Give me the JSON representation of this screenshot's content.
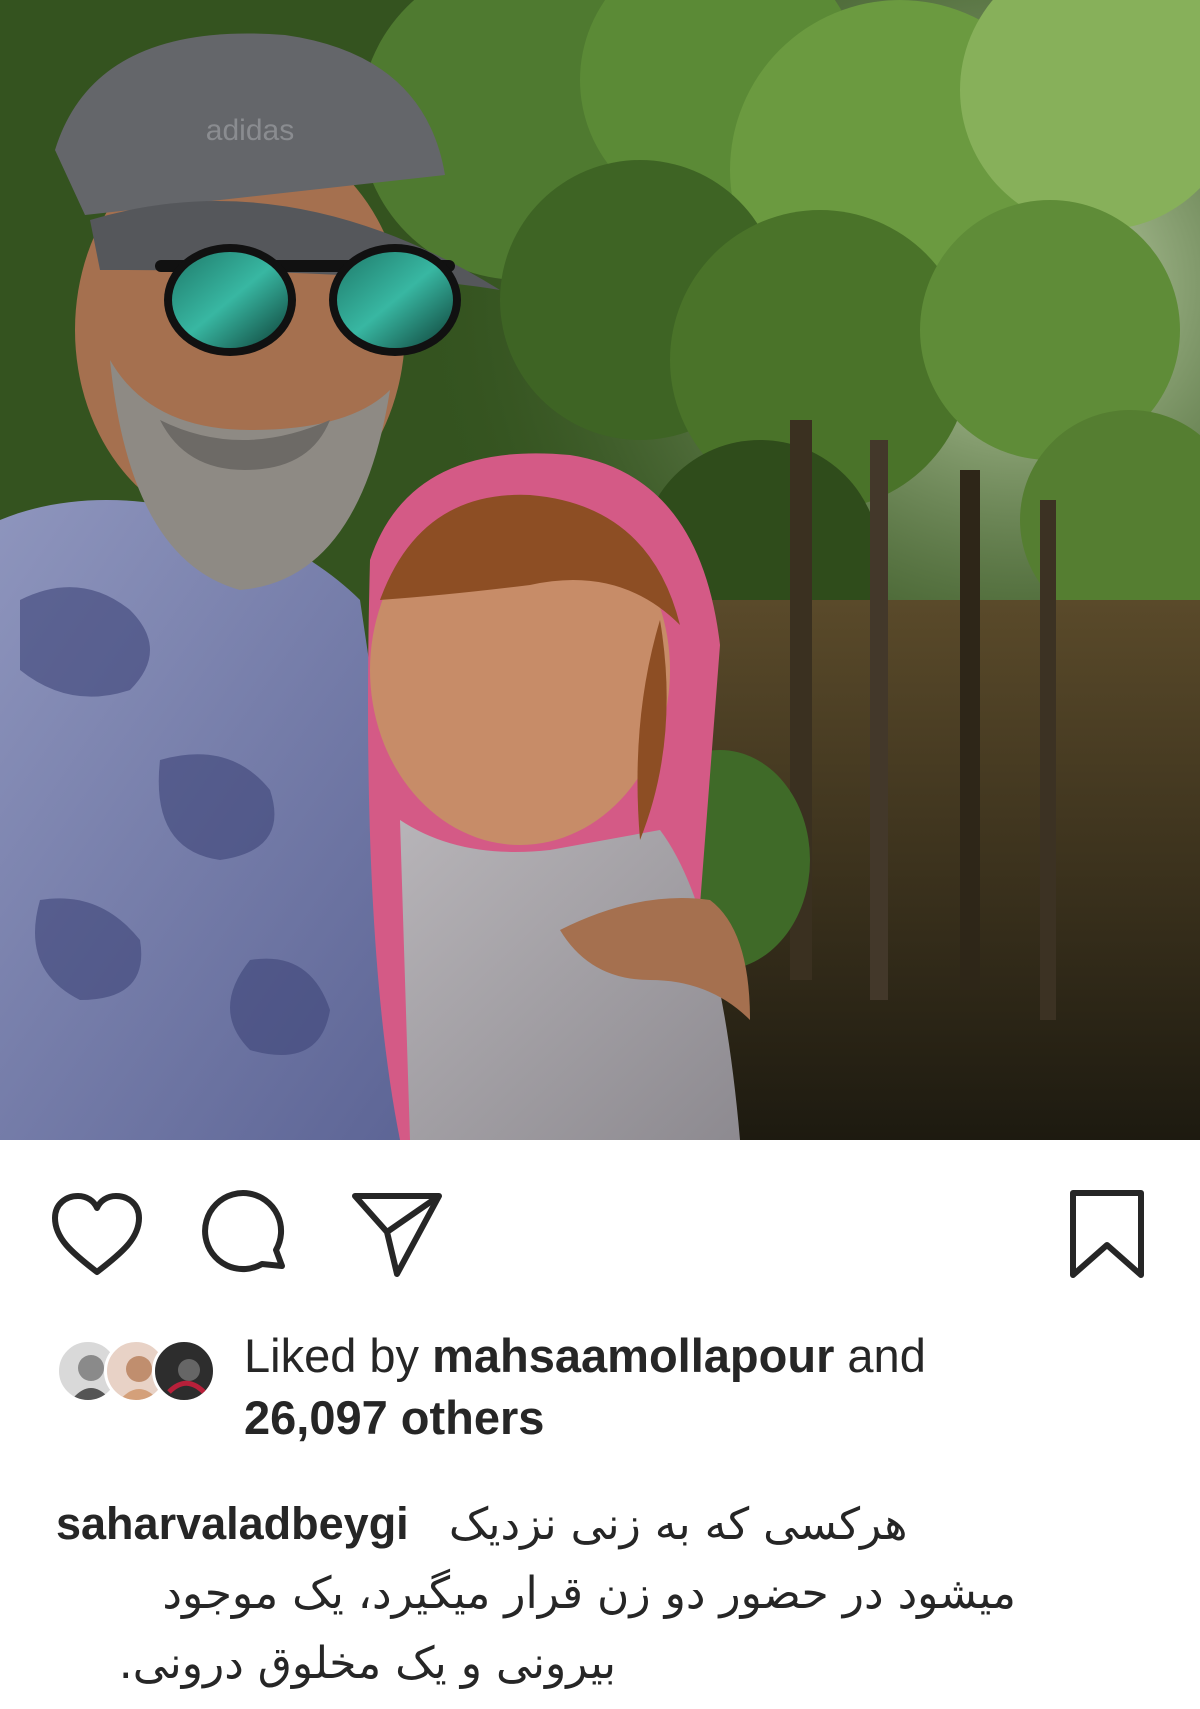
{
  "post": {
    "image_alt": "Selfie of a bearded man in an adidas cap and mirrored sunglasses hugging a smiling woman in a pink hood under trees",
    "cap_brand_text": "adidas"
  },
  "actions": {
    "like_icon": "heart-icon",
    "comment_icon": "comment-icon",
    "share_icon": "paper-plane-icon",
    "save_icon": "bookmark-icon"
  },
  "likes": {
    "prefix": "Liked by",
    "user": "mahsaamollapour",
    "conj": "and",
    "others": "26,097 others"
  },
  "caption": {
    "username": "saharvaladbeygi",
    "line1": "هرکسی که به زنی نزدیک",
    "line2": "میشود در حضور دو زن قرار میگیرد، یک موجود",
    "line3": "بیرونی و یک مخلوق درونی."
  },
  "colors": {
    "text": "#262626",
    "background": "#ffffff"
  }
}
